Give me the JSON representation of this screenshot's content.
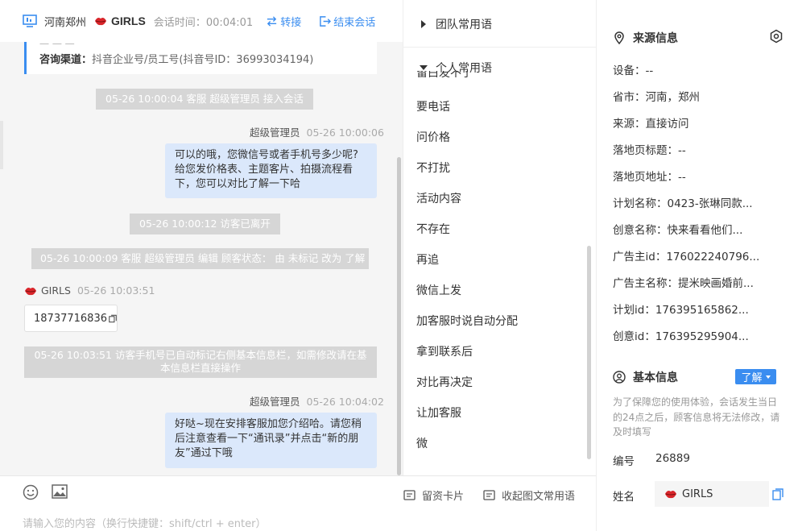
{
  "header": {
    "region": "河南郑州",
    "visitor_name": "GIRLS",
    "session_time_label": "会话时间：",
    "session_time": "00:04:01",
    "transfer_label": "转接",
    "end_label": "结束会话"
  },
  "channel": {
    "cut_text": "一 一 一",
    "label": "咨询渠道：",
    "value": "抖音企业号/员工号(抖音号ID：36993034194)"
  },
  "messages": {
    "sys1": "05-26 10:00:04 客服 超级管理员 接入会话",
    "agent1_name": "超级管理员",
    "agent1_time": "05-26 10:00:06",
    "agent1_line1": "可以的哦，您微信号或者手机号多少呢?",
    "agent1_line2": "给您发价格表、主题客片、拍摄流程看",
    "agent1_line3": "下，您可以对比了解一下哈",
    "sys2": "05-26 10:00:12 访客已离开",
    "sys3": "05-26 10:00:09 客服 超级管理员 编辑 顾客状态： 由 未标记 改为 了解",
    "visitor_name": "GIRLS",
    "visitor_time": "05-26 10:03:51",
    "visitor_phone": "18737716836",
    "sys4_line1": "05-26 10:03:51 访客手机号已自动标记右侧基本信息栏，如需修改请在基",
    "sys4_line2": "本信息栏直接操作",
    "agent2_name": "超级管理员",
    "agent2_time": "05-26 10:04:02",
    "agent2_line1": "好哒~现在安排客服加您介绍哈。请您稍",
    "agent2_line2": "后注意查看一下“通讯录”并点击“新的朋",
    "agent2_line3": "友”通过下哦"
  },
  "input": {
    "placeholder": "请输入您的内容（换行快捷键：shift/ctrl + enter）",
    "card_label": "留资卡片",
    "collapse_label": "收起图文常用语"
  },
  "phrases": {
    "team_label": "团队常用语",
    "personal_label": "个人常用语",
    "partial_item": "留白发不了",
    "items": [
      "要电话",
      "问价格",
      "不打扰",
      "活动内容",
      "不存在",
      "再追",
      "微信上发",
      "加客服时说自动分配",
      "拿到联系后",
      "对比再决定",
      "让加客服",
      "微"
    ]
  },
  "info": {
    "source_title": "来源信息",
    "device": "设备：--",
    "province": "省市：河南，郑州",
    "source": "来源：直接访问",
    "landing_title": "落地页标题：--",
    "landing_url": "落地页地址：--",
    "plan_name": "计划名称：0423-张琳同款...",
    "creative_name": "创意名称：快来看看他们...",
    "advertiser_id": "广告主id：176022240796...",
    "advertiser_name": "广告主名称：提米映画婚前...",
    "plan_id": "计划id：176395165862...",
    "creative_id": "创意id：176395295904...",
    "basic_title": "基本信息",
    "status_value": "了解",
    "hint": "为了保障您的使用体验，会话发生当日的24点之后，顾客信息将无法修改，请及时填写",
    "number_label": "编号",
    "number_value": "26889",
    "name_label": "姓名",
    "name_value": "GIRLS"
  },
  "colors": {
    "accent": "#3a8df0",
    "bubble": "#dbe8fb",
    "system_message": "#d6d6d6",
    "chat_bg": "#f5f5f5",
    "lips": "#d9262b"
  },
  "icons": [
    "monitor-icon",
    "lips-icon",
    "transfer-icon",
    "end-session-icon",
    "emoji-icon",
    "image-icon",
    "card-icon",
    "collapse-icon",
    "location-icon",
    "settings-icon",
    "user-icon",
    "copy-icon",
    "triangle-right-icon",
    "triangle-down-icon"
  ]
}
